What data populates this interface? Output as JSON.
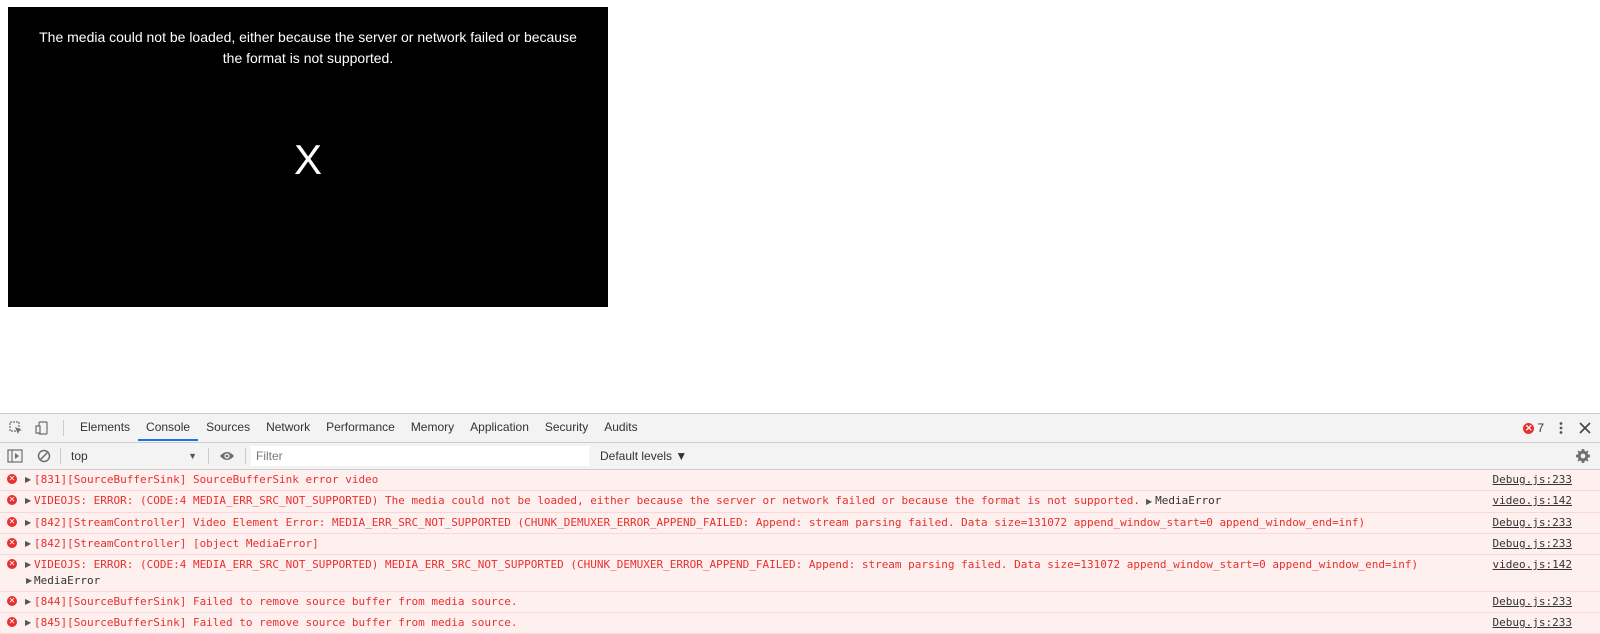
{
  "player": {
    "error_message": "The media could not be loaded, either because the server or network failed or because the format is not supported.",
    "error_close_symbol": "X"
  },
  "devtools": {
    "tabs": [
      {
        "label": "Elements"
      },
      {
        "label": "Console"
      },
      {
        "label": "Sources"
      },
      {
        "label": "Network"
      },
      {
        "label": "Performance"
      },
      {
        "label": "Memory"
      },
      {
        "label": "Application"
      },
      {
        "label": "Security"
      },
      {
        "label": "Audits"
      }
    ],
    "active_tab": "Console",
    "error_count": "7",
    "accent_color": "#1a73e8",
    "error_color": "#e8302d"
  },
  "console_toolbar": {
    "context": "top",
    "filter_placeholder": "Filter",
    "levels": "Default levels ▼"
  },
  "messages": [
    {
      "text": "[831][SourceBufferSink] SourceBufferSink error video",
      "source": "Debug.js:233"
    },
    {
      "text": "VIDEOJS: ERROR: (CODE:4 MEDIA_ERR_SRC_NOT_SUPPORTED) The media could not be loaded, either because the server or network failed or because the format is not supported.",
      "object": "MediaError",
      "source": "video.js:142"
    },
    {
      "text": "[842][StreamController] Video Element Error: MEDIA_ERR_SRC_NOT_SUPPORTED (CHUNK_DEMUXER_ERROR_APPEND_FAILED: Append: stream parsing failed. Data size=131072 append_window_start=0 append_window_end=inf)",
      "source": "Debug.js:233"
    },
    {
      "text": "[842][StreamController] [object MediaError]",
      "source": "Debug.js:233"
    },
    {
      "text": "VIDEOJS: ERROR: (CODE:4 MEDIA_ERR_SRC_NOT_SUPPORTED) MEDIA_ERR_SRC_NOT_SUPPORTED (CHUNK_DEMUXER_ERROR_APPEND_FAILED: Append: stream parsing failed. Data size=131072 append_window_start=0 append_window_end=inf)",
      "line2": "MediaError",
      "source": "video.js:142"
    },
    {
      "text": "[844][SourceBufferSink] Failed to remove source buffer from media source.",
      "source": "Debug.js:233"
    },
    {
      "text": "[845][SourceBufferSink] Failed to remove source buffer from media source.",
      "source": "Debug.js:233"
    }
  ]
}
